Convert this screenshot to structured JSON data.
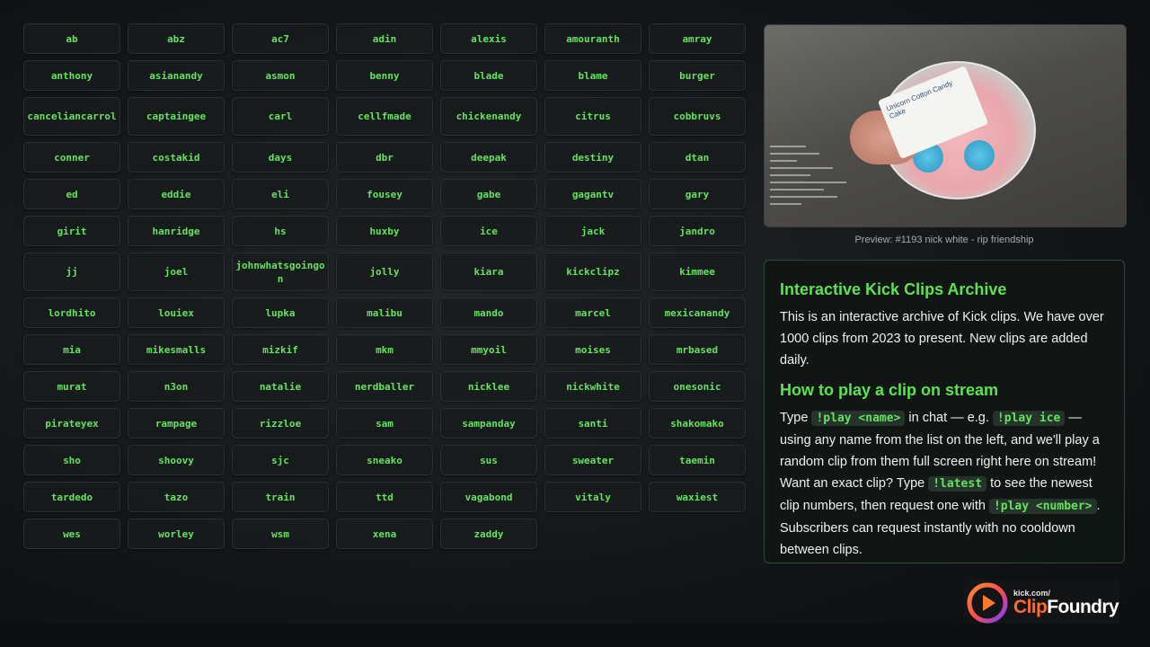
{
  "clips": [
    "ab",
    "abz",
    "ac7",
    "adin",
    "alexis",
    "amouranth",
    "amray",
    "anthony",
    "asianandy",
    "asmon",
    "benny",
    "blade",
    "blame",
    "burger",
    "canceliancarrol",
    "captaingee",
    "carl",
    "cellfmade",
    "chickenandy",
    "citrus",
    "cobbruvs",
    "conner",
    "costakid",
    "days",
    "dbr",
    "deepak",
    "destiny",
    "dtan",
    "ed",
    "eddie",
    "eli",
    "fousey",
    "gabe",
    "gagantv",
    "gary",
    "girit",
    "hanridge",
    "hs",
    "huxby",
    "ice",
    "jack",
    "jandro",
    "jj",
    "joel",
    "johnwhatsgoingon",
    "jolly",
    "kiara",
    "kickclipz",
    "kimmee",
    "lordhito",
    "louiex",
    "lupka",
    "malibu",
    "mando",
    "marcel",
    "mexicanandy",
    "mia",
    "mikesmalls",
    "mizkif",
    "mkm",
    "mmyoil",
    "moises",
    "mrbased",
    "murat",
    "n3on",
    "natalie",
    "nerdballer",
    "nicklee",
    "nickwhite",
    "onesonic",
    "pirateyex",
    "rampage",
    "rizzloe",
    "sam",
    "sampanday",
    "santi",
    "shakomako",
    "sho",
    "shoovy",
    "sjc",
    "sneako",
    "sus",
    "sweater",
    "taemin",
    "tardedo",
    "tazo",
    "train",
    "ttd",
    "vagabond",
    "vitaly",
    "waxiest",
    "wes",
    "worley",
    "wsm",
    "xena",
    "zaddy"
  ],
  "preview": {
    "caption": "Preview: #1193 nick white - rip friendship",
    "label_text": "Unicorn Cotton Candy Cake"
  },
  "info": {
    "title": "Interactive Kick Clips Archive",
    "intro": "This is an interactive archive of Kick clips. We have over 1000 clips from 2023 to present. New clips are added daily.",
    "howto_title": "How to play a clip on stream",
    "p1": "Type",
    "code_play_name": "!play <name>",
    "p2": "in chat — e.g.",
    "code_play_ice": "!play ice",
    "p3": "— using any name from the list on the left, and we'll play a random clip from them full screen right here on stream! Want an exact clip? Type",
    "code_latest": "!latest",
    "p4": "to see the newest clip numbers, then request one with",
    "code_play_number": "!play <number>",
    "p5": ". Subscribers can request instantly with no cooldown between clips."
  },
  "logo": {
    "small": "kick.com/",
    "clip": "Clip",
    "foundry": "Foundry"
  },
  "colors": {
    "accent_green": "#63e35e",
    "logo_orange": "#ff6b2b",
    "logo_purple": "#7a3cff"
  }
}
